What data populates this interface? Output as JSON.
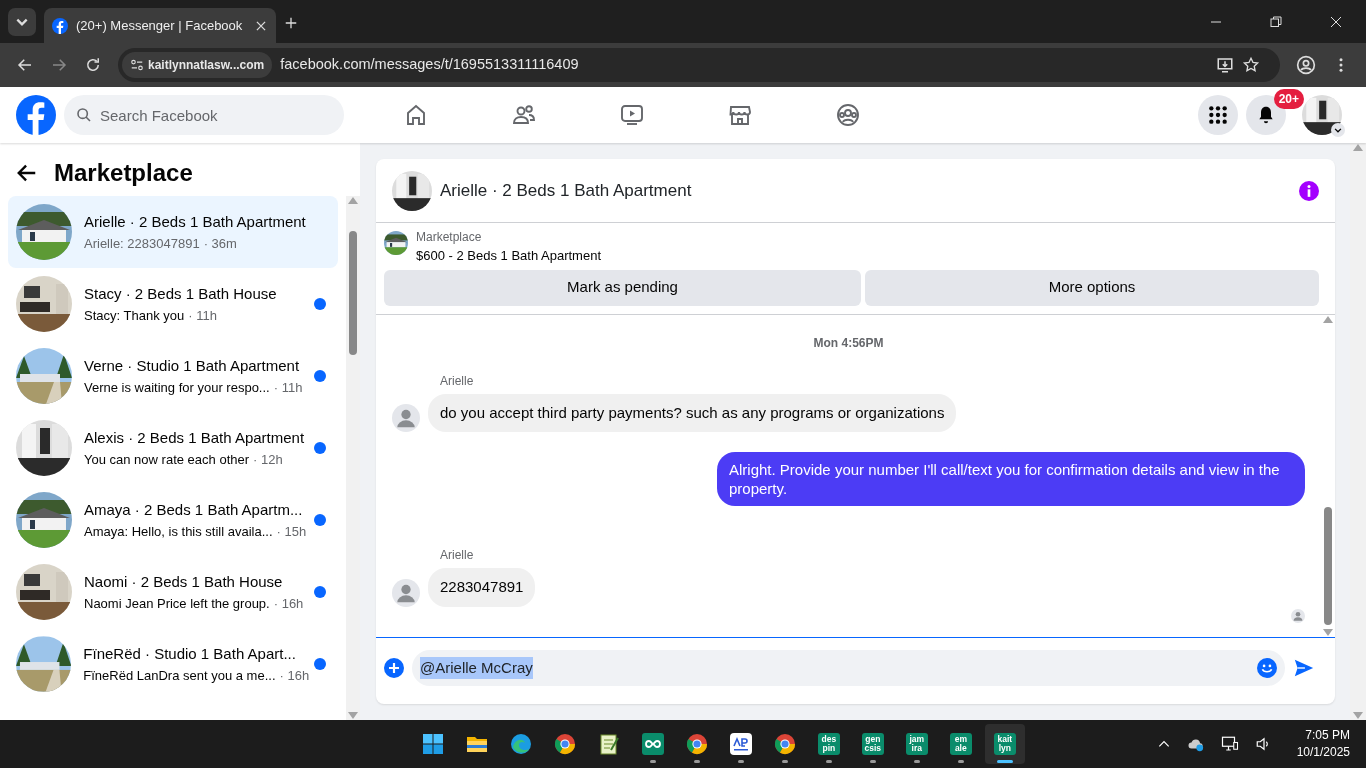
{
  "browser": {
    "tab_title": "(20+) Messenger | Facebook",
    "site_chip": "kaitlynnatlasw...com",
    "url": "facebook.com/messages/t/1695513311116409"
  },
  "topbar": {
    "search": {
      "placeholder": "Search Facebook"
    },
    "notification_badge": "20+"
  },
  "sidebar": {
    "title": "Marketplace",
    "conversations": [
      {
        "title": "Arielle · 2 Beds 1 Bath Apartment",
        "preview": "Arielle: 2283047891",
        "time": "· 36m",
        "unread": false,
        "selected": true
      },
      {
        "title": "Stacy · 2 Beds 1 Bath House",
        "preview": "Stacy: Thank you",
        "time": "· 11h",
        "unread": true,
        "selected": false
      },
      {
        "title": "Verne · Studio 1 Bath Apartment",
        "preview": "Verne is waiting for your respo...",
        "time": "· 11h",
        "unread": true,
        "selected": false
      },
      {
        "title": "Alexis · 2 Beds 1 Bath Apartment",
        "preview": "You can now rate each other",
        "time": "· 12h",
        "unread": true,
        "selected": false
      },
      {
        "title": "Amaya · 2 Beds 1 Bath Apartm...",
        "preview": "Amaya: Hello, is this still availa...",
        "time": "· 15h",
        "unread": true,
        "selected": false
      },
      {
        "title": "Naomi · 2 Beds 1 Bath House",
        "preview": "Naomi Jean Price left the group.",
        "time": "· 16h",
        "unread": true,
        "selected": false
      },
      {
        "title": "FïneRëd · Studio 1 Bath Apart...",
        "preview": "FïneRëd LanDra sent you a me...",
        "time": "· 16h",
        "unread": true,
        "selected": false
      }
    ]
  },
  "chat": {
    "title": "Arielle · 2 Beds 1 Bath Apartment",
    "listing": {
      "label": "Marketplace",
      "text": "$600 - 2 Beds 1 Bath Apartment"
    },
    "buttons": [
      "Mark as pending",
      "More options"
    ],
    "timestamp": "Mon 4:56PM",
    "messages": [
      {
        "sender": "Arielle",
        "text": "do you accept third party payments? such as any programs or organizations",
        "outgoing": false
      },
      {
        "text": "Alright. Provide your number I'll call/text you for confirmation details and view in the property.",
        "outgoing": true
      },
      {
        "sender": "Arielle",
        "text": "2283047891",
        "outgoing": false
      }
    ],
    "composer": {
      "value": "@Arielle McCray",
      "value_selected": true
    }
  },
  "taskbar": {
    "apps": [
      {
        "kind": "windows",
        "running": false,
        "active": false
      },
      {
        "kind": "folder",
        "running": false,
        "active": false
      },
      {
        "kind": "edge",
        "running": false,
        "active": false
      },
      {
        "kind": "chrome",
        "running": false,
        "active": false
      },
      {
        "kind": "notepad",
        "running": false,
        "active": false
      },
      {
        "kind": "infinity",
        "running": true,
        "active": false
      },
      {
        "kind": "chrome",
        "running": true,
        "active": false
      },
      {
        "kind": "proxy",
        "running": true,
        "active": false
      },
      {
        "kind": "chrome",
        "running": true,
        "active": false
      },
      {
        "kind": "tile",
        "label": "des pin",
        "running": true,
        "active": false
      },
      {
        "kind": "tile",
        "label": "gen csis",
        "running": true,
        "active": false
      },
      {
        "kind": "tile",
        "label": "jam ira",
        "running": true,
        "active": false
      },
      {
        "kind": "tile",
        "label": "em ale",
        "running": true,
        "active": false
      },
      {
        "kind": "tile",
        "label": "kait lyn",
        "running": true,
        "active": true
      }
    ],
    "time": "7:05 PM",
    "date": "10/1/2025"
  }
}
